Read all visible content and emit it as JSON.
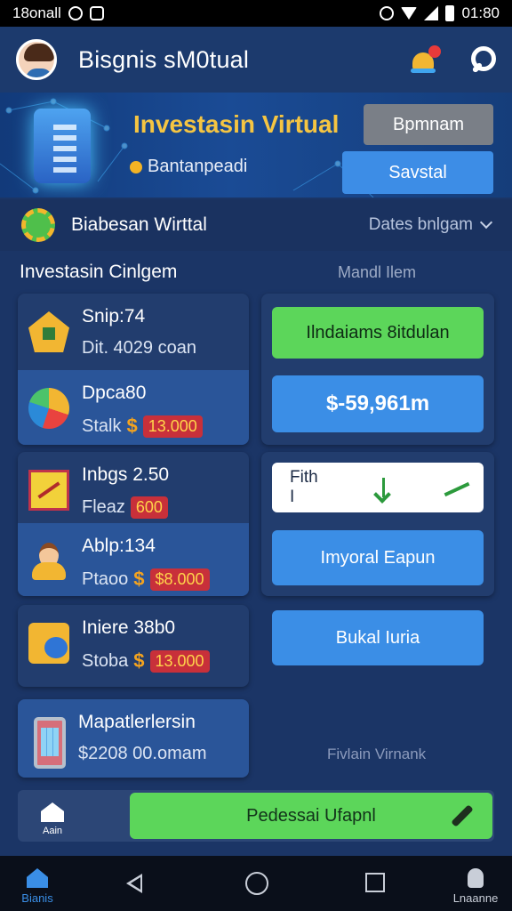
{
  "status_bar": {
    "left_text": "18onall",
    "time": "01:80"
  },
  "app_bar": {
    "title": "Bisgnis sM0tual"
  },
  "hero": {
    "title": "Investasin Virtual",
    "subtitle": "Bantanpeadi",
    "button_gray": "Bpmnam",
    "button_blue": "Savstal"
  },
  "filter": {
    "label": "Biabesan Wirttal",
    "dropdown": "Dates bnlgam"
  },
  "section": {
    "title": "Investasin Cinlgem",
    "right_label": "Mandl Ilem"
  },
  "items": [
    {
      "title": "Snip:74",
      "sub": "Dit.  4029 coan"
    },
    {
      "title": "Dpca80",
      "sub": "Stalk",
      "currency": "$",
      "badge": "13.000"
    },
    {
      "title": "Inbgs 2.50",
      "sub": "Fleaz",
      "badge": "600"
    },
    {
      "title": "Ablp:134",
      "sub": "Ptaoo",
      "currency": "$",
      "badge": "$8.000"
    },
    {
      "title": "Iniere 38b0",
      "sub": "Stoba",
      "currency": "$",
      "badge": "13.000"
    },
    {
      "title": "Mapatlerlersin",
      "sub": "$2208 00.omam"
    }
  ],
  "right_panel": {
    "green_button": "Ilndaiams 8itdulan",
    "amount": "$-59,961m",
    "row_label": "Fith I",
    "blue_button_1": "Imyoral  Eapun",
    "blue_button_2": "Bukal Iuria",
    "footer_note": "Fivlain Virnank"
  },
  "action_bar": {
    "home_label": "Aain",
    "cta": "Pedessai Ufapnl"
  },
  "nav": {
    "home_label": "Bianis",
    "profile_label": "Lnaanne"
  },
  "colors": {
    "accent_green": "#5cd65a",
    "accent_blue": "#3b8ee6",
    "gold": "#f5c542",
    "badge_red": "#c8303a"
  }
}
